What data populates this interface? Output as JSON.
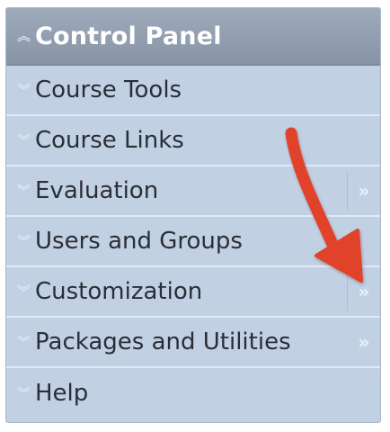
{
  "panel": {
    "title": "Control Panel",
    "title_icon": "double-chevron-up-icon",
    "items": [
      {
        "label": "Course Tools",
        "icon": "double-chevron-down-icon",
        "has_flyout": false
      },
      {
        "label": "Course Links",
        "icon": "double-chevron-down-icon",
        "has_flyout": false
      },
      {
        "label": "Evaluation",
        "icon": "double-chevron-down-icon",
        "has_flyout": true
      },
      {
        "label": "Users and Groups",
        "icon": "double-chevron-down-icon",
        "has_flyout": false
      },
      {
        "label": "Customization",
        "icon": "double-chevron-down-icon",
        "has_flyout": true
      },
      {
        "label": "Packages and Utilities",
        "icon": "double-chevron-down-icon",
        "has_flyout": true
      },
      {
        "label": "Help",
        "icon": "double-chevron-down-icon",
        "has_flyout": false
      }
    ]
  },
  "annotation": {
    "icon": "red-arrow-icon",
    "color": "#e0432a"
  }
}
